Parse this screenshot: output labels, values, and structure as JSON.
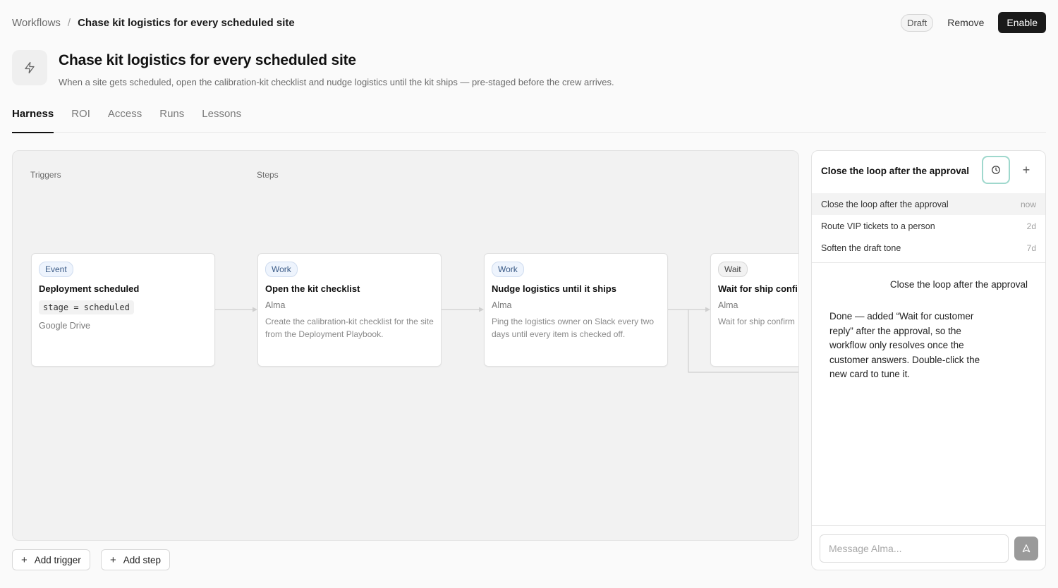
{
  "breadcrumb": {
    "root": "Workflows",
    "separator": "/",
    "current": "Chase kit logistics for every scheduled site"
  },
  "actions": {
    "status": "Draft",
    "remove_label": "Remove",
    "enable_label": "Enable"
  },
  "header": {
    "icon": "lightning-icon",
    "title": "Chase kit logistics for every scheduled site",
    "description": "When a site gets scheduled, open the calibration-kit checklist and nudge logistics until the kit ships — pre-staged before the crew arrives."
  },
  "tabs": [
    {
      "label": "Harness",
      "active": true
    },
    {
      "label": "ROI",
      "active": false
    },
    {
      "label": "Access",
      "active": false
    },
    {
      "label": "Runs",
      "active": false
    },
    {
      "label": "Lessons",
      "active": false
    }
  ],
  "canvas": {
    "triggers_label": "Triggers",
    "steps_label": "Steps",
    "trigger": {
      "type": "Event",
      "title": "Deployment scheduled",
      "condition": "stage = scheduled",
      "source": "Google Drive"
    },
    "steps": [
      {
        "type": "Work",
        "title": "Open the kit checklist",
        "owner": "Alma",
        "description": "Create the calibration-kit checklist for the site from the Deployment Playbook."
      },
      {
        "type": "Work",
        "title": "Nudge logistics until it ships",
        "owner": "Alma",
        "description": "Ping the logistics owner on Slack every two days until every item is checked off."
      },
      {
        "type": "Wait",
        "title": "Wait for ship confi",
        "owner": "Alma",
        "description": "Wait for ship confirm"
      }
    ],
    "add_trigger_label": "Add trigger",
    "add_step_label": "Add step"
  },
  "chat": {
    "title": "Close the loop after the approval",
    "history": [
      {
        "title": "Close the loop after the approval",
        "time": "now",
        "active": true
      },
      {
        "title": "Route VIP tickets to a person",
        "time": "2d",
        "active": false
      },
      {
        "title": "Soften the draft tone",
        "time": "7d",
        "active": false
      }
    ],
    "user_message": "Close the loop after the approval",
    "assistant_message": "Done — added “Wait for customer reply” after the approval, so the workflow only resolves once the customer answers. Double-click the new card to tune it.",
    "composer_placeholder": "Message Alma..."
  },
  "colors": {
    "event_pill": "#eef4fd",
    "wait_pill": "#f2f2f2",
    "history_button_border": "#9fd8cd",
    "enable_button": "#1a1a1a"
  }
}
